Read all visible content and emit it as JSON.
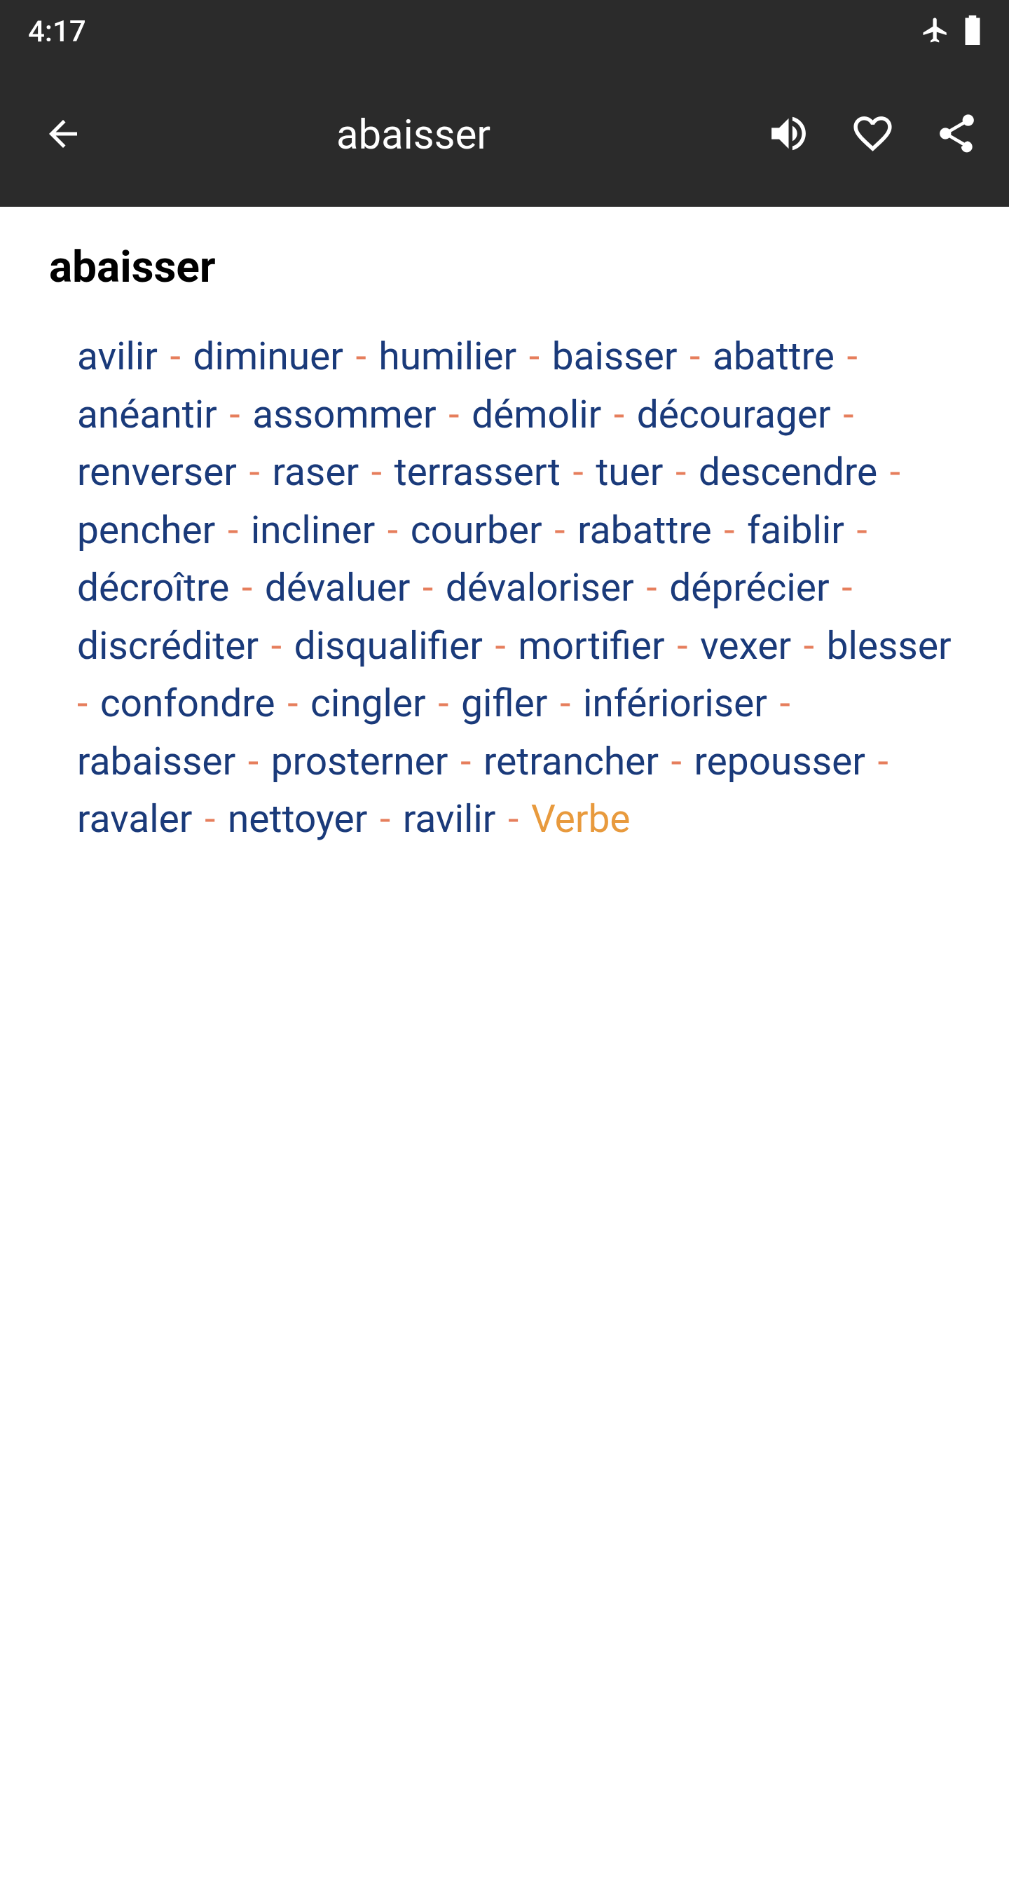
{
  "status": {
    "time": "4:17"
  },
  "appbar": {
    "title": "abaisser"
  },
  "content": {
    "heading": "abaisser",
    "synonyms": [
      "avilir",
      "diminuer",
      "humilier",
      "baisser",
      "abattre",
      "anéantir",
      "assommer",
      "démolir",
      "décourager",
      "renverser",
      "raser",
      "terrassert",
      "tuer",
      "descendre",
      "pencher",
      "incliner",
      "courber",
      "rabattre",
      "faiblir",
      "décroître",
      "dévaluer",
      "dévaloriser",
      "déprécier",
      "discréditer",
      "disqualifier",
      "mortifier",
      "vexer",
      "blesser",
      "confondre",
      "cingler",
      "gifler",
      "inférioriser",
      "rabaisser",
      "prosterner",
      "retrancher",
      "repousser",
      "ravaler",
      "nettoyer",
      "ravilir"
    ],
    "part_of_speech": "Verbe",
    "separator": "-"
  }
}
